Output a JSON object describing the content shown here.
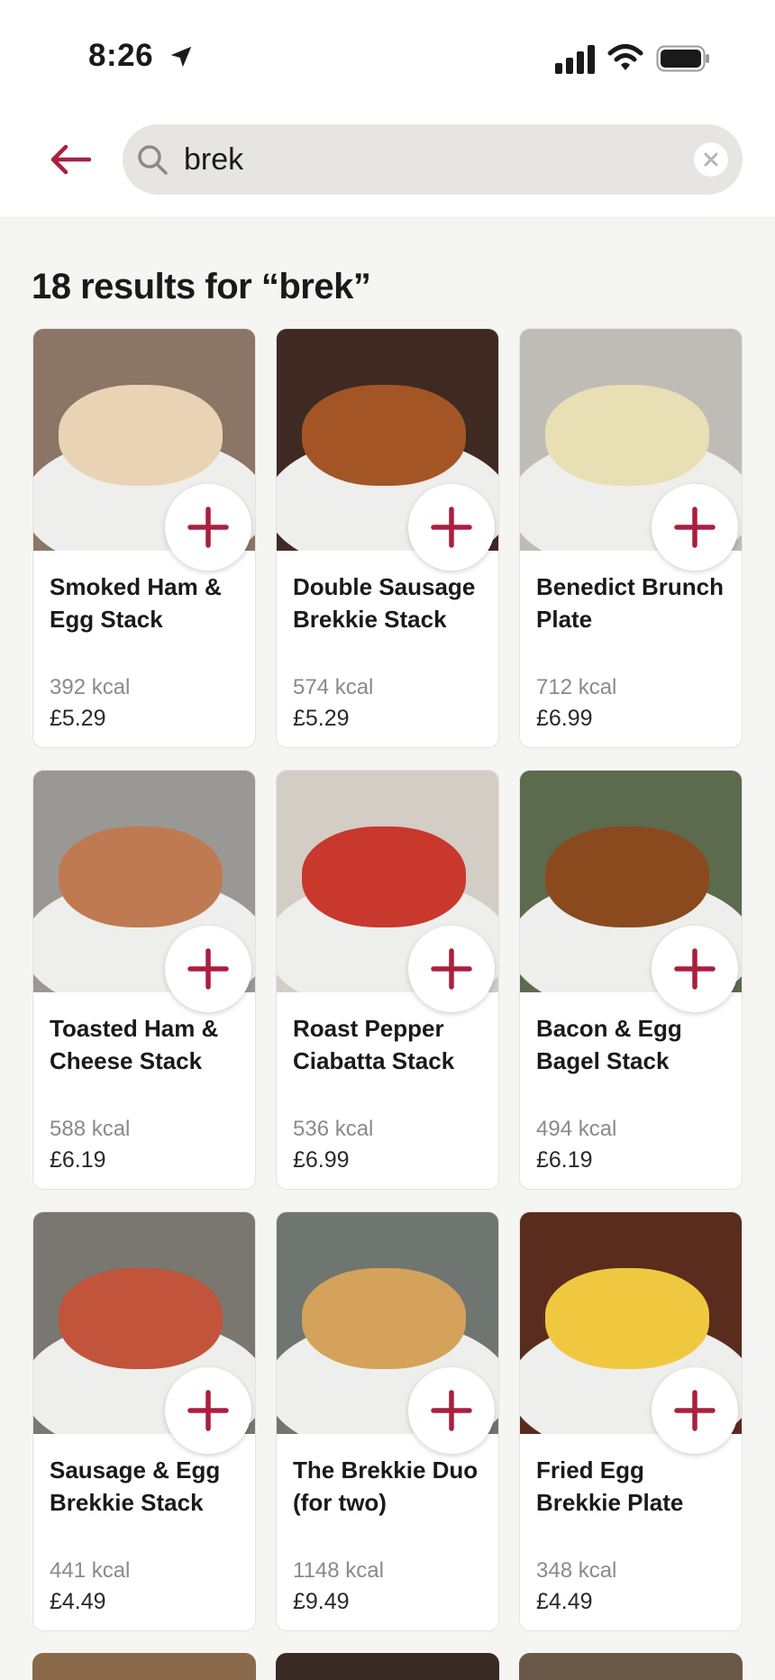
{
  "status_bar": {
    "time": "8:26"
  },
  "search": {
    "query": "brek",
    "placeholder": ""
  },
  "results": {
    "title": "18 results for “brek”"
  },
  "icons": {
    "back": "arrow-left-icon",
    "search": "search-icon",
    "clear": "close-circle-icon",
    "add": "plus-icon"
  },
  "colors": {
    "accent": "#ab1f3e",
    "search_bg": "#e6e5e1",
    "page_bg": "#f5f5f4"
  },
  "products": [
    {
      "name": "Smoked Ham & Egg Stack",
      "kcal": "392 kcal",
      "price": "£5.29",
      "bg": "#8b7566",
      "food": "#e8d4b4"
    },
    {
      "name": "Double Sausage Brekkie Stack",
      "kcal": "574 kcal",
      "price": "£5.29",
      "bg": "#3e2a22",
      "food": "#a35526"
    },
    {
      "name": "Benedict Brunch Plate",
      "kcal": "712 kcal",
      "price": "£6.99",
      "bg": "#bfbcb8",
      "food": "#e9dfb4"
    },
    {
      "name": "Toasted Ham & Cheese Stack",
      "kcal": "588 kcal",
      "price": "£6.19",
      "bg": "#9a9894",
      "food": "#c07a52"
    },
    {
      "name": "Roast Pepper Ciabatta Stack",
      "kcal": "536 kcal",
      "price": "£6.99",
      "bg": "#d3cdc6",
      "food": "#c8382c"
    },
    {
      "name": "Bacon & Egg Bagel Stack",
      "kcal": "494 kcal",
      "price": "£6.19",
      "bg": "#5c6a4e",
      "food": "#8a4a1e"
    },
    {
      "name": "Sausage & Egg Brekkie Stack",
      "kcal": "441 kcal",
      "price": "£4.49",
      "bg": "#7a7770",
      "food": "#c1543a"
    },
    {
      "name": "The Brekkie Duo (for two)",
      "kcal": "1148 kcal",
      "price": "£9.49",
      "bg": "#6f7570",
      "food": "#d4a25a"
    },
    {
      "name": "Fried Egg Brekkie Plate",
      "kcal": "348 kcal",
      "price": "£4.49",
      "bg": "#5a2c1e",
      "food": "#f0c840"
    }
  ]
}
